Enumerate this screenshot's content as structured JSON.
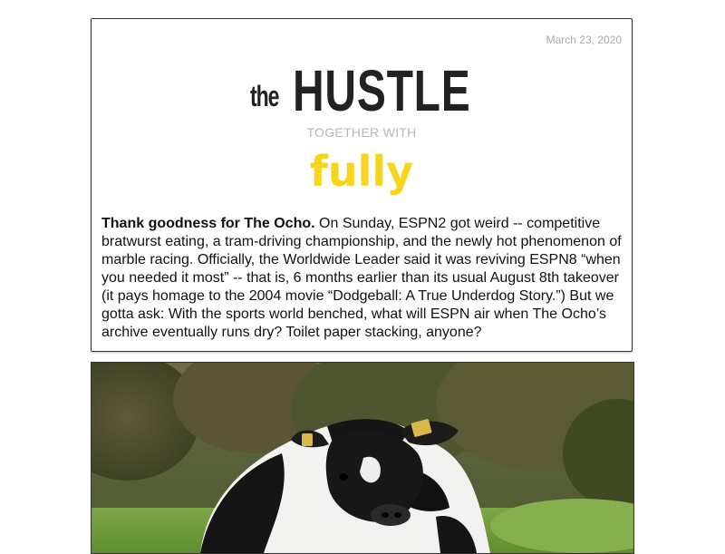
{
  "email": {
    "date": "March 23, 2020",
    "logo": {
      "the": "the",
      "hustle": "HUSTLE"
    },
    "together_with": "TOGETHER WITH",
    "partner": "fully",
    "lead_bold": "Thank goodness for The Ocho.",
    "lead_text": " On Sunday, ESPN2 got weird -- competitive bratwurst eating, a tram-driving championship, and the newly hot phenomenon of marble racing. Officially, the Worldwide Leader said it was reviving ESPN8 “when you needed it most” -- that is, 6 months earlier than its usual August 8th takeover (it pays homage to the 2004 movie “Dodgeball: A True Underdog Story.”) But we gotta ask: With the sports world benched, what will ESPN air when The Ocho’s archive eventually runs dry? Toilet paper stacking, anyone?"
  },
  "colors": {
    "partner_brand": "#f7d51d",
    "date_text": "#aaaaaa",
    "together_text": "#b8b8b8",
    "logo_text": "#222222"
  },
  "image": {
    "subject": "cow-photo"
  }
}
